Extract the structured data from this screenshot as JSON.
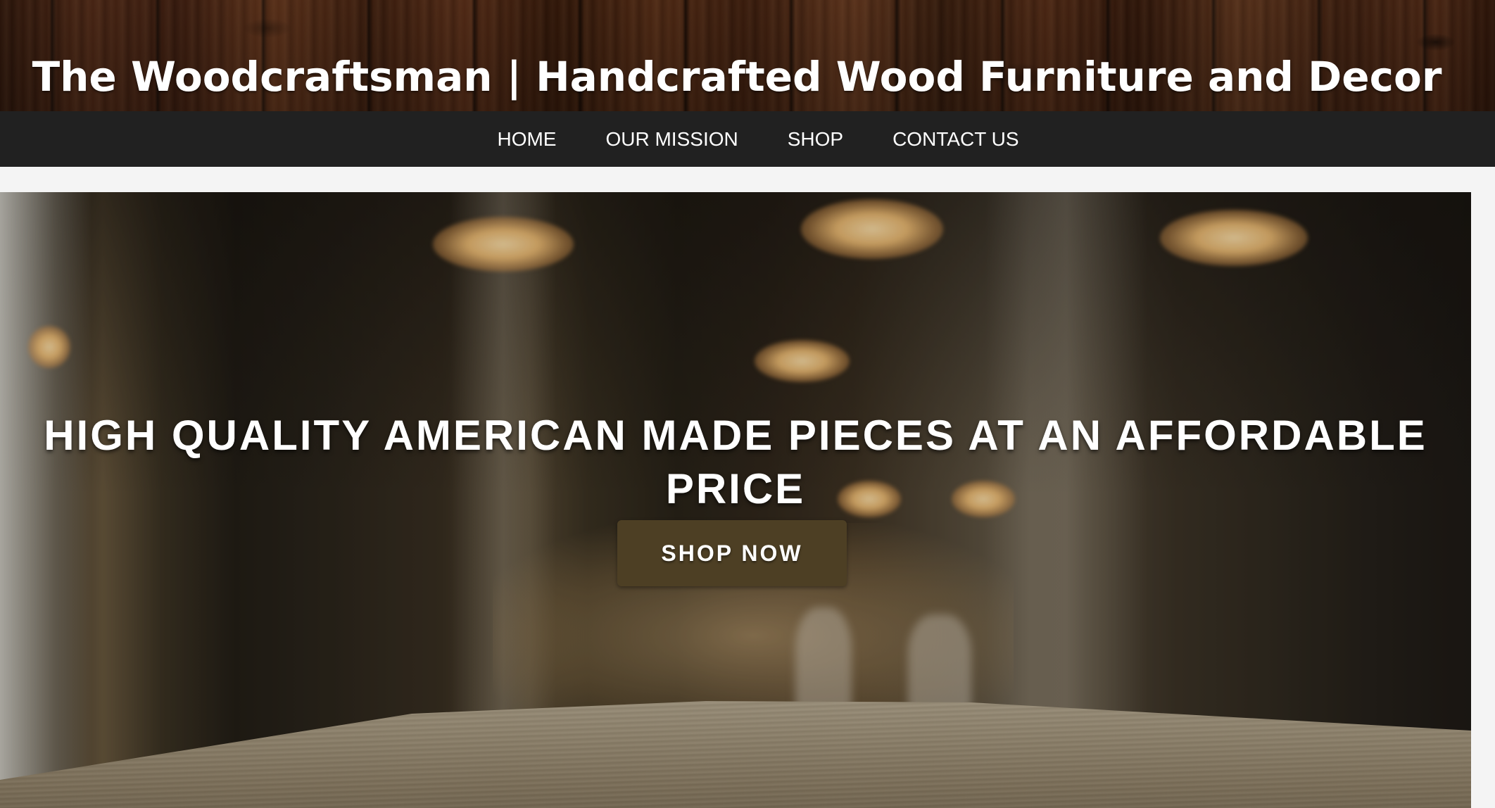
{
  "header": {
    "site_title": "The Woodcraftsman | Handcrafted Wood Furniture and Decor"
  },
  "nav": {
    "items": [
      {
        "label": "HOME"
      },
      {
        "label": "OUR MISSION"
      },
      {
        "label": "SHOP"
      },
      {
        "label": "CONTACT US"
      }
    ]
  },
  "hero": {
    "headline": "HIGH QUALITY AMERICAN MADE PIECES AT AN AFFORDABLE PRICE",
    "cta_label": "SHOP NOW"
  },
  "colors": {
    "nav_background": "#212121",
    "button_background": "#4d3f24",
    "text": "#ffffff",
    "page_background": "#f4f4f4"
  }
}
